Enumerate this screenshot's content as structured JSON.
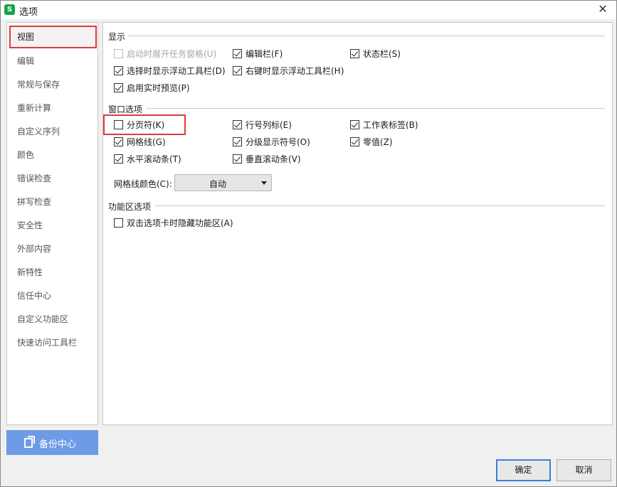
{
  "window": {
    "title": "选项",
    "app_icon_letter": "S",
    "close_glyph": "✕"
  },
  "sidebar": {
    "items": [
      {
        "label": "视图"
      },
      {
        "label": "编辑"
      },
      {
        "label": "常规与保存"
      },
      {
        "label": "重新计算"
      },
      {
        "label": "自定义序列"
      },
      {
        "label": "颜色"
      },
      {
        "label": "错误检查"
      },
      {
        "label": "拼写检查"
      },
      {
        "label": "安全性"
      },
      {
        "label": "外部内容"
      },
      {
        "label": "新特性"
      },
      {
        "label": "信任中心"
      },
      {
        "label": "自定义功能区"
      },
      {
        "label": "快速访问工具栏"
      }
    ],
    "active_index": 0
  },
  "backup": {
    "label": "备份中心"
  },
  "display": {
    "title": "显示",
    "options": [
      {
        "label": "启动时展开任务窗格(U)",
        "checked": false,
        "disabled": true
      },
      {
        "label": "编辑栏(F)",
        "checked": true
      },
      {
        "label": "状态栏(S)",
        "checked": true
      },
      {
        "label": "选择时显示浮动工具栏(D)",
        "checked": true
      },
      {
        "label": "右键时显示浮动工具栏(H)",
        "checked": true
      },
      {
        "label": "启用实时预览(P)",
        "checked": true
      }
    ]
  },
  "window_options": {
    "title": "窗口选项",
    "options": [
      {
        "label": "分页符(K)",
        "checked": false
      },
      {
        "label": "行号列标(E)",
        "checked": true
      },
      {
        "label": "工作表标签(B)",
        "checked": true
      },
      {
        "label": "网格线(G)",
        "checked": true
      },
      {
        "label": "分级显示符号(O)",
        "checked": true
      },
      {
        "label": "零值(Z)",
        "checked": true
      },
      {
        "label": "水平滚动条(T)",
        "checked": true
      },
      {
        "label": "垂直滚动条(V)",
        "checked": true
      }
    ],
    "gridline_color": {
      "label": "网格线颜色(C):",
      "value": "自动"
    }
  },
  "ribbon": {
    "title": "功能区选项",
    "options": [
      {
        "label": "双击选项卡时隐藏功能区(A)",
        "checked": false
      }
    ]
  },
  "footer": {
    "ok_label": "确定",
    "cancel_label": "取消"
  },
  "colors": {
    "highlight": "#e03a3a",
    "primary_border": "#3c7fd6",
    "backup_bg": "#6e9be8",
    "app_icon": "#17a34a"
  }
}
